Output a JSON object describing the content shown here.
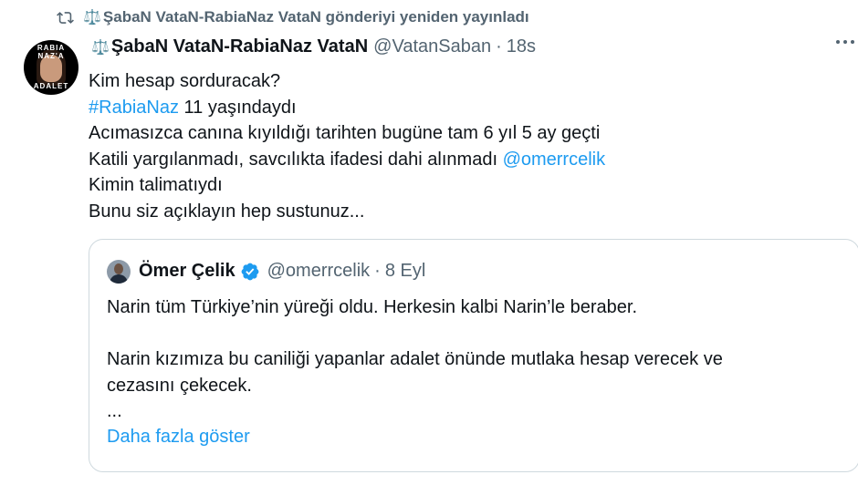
{
  "repost": {
    "icon": "repost-icon",
    "text": "ŞabaN VataN-RabiaNaz VataN gönderiyi yeniden yayınladı"
  },
  "tweet": {
    "avatar_text_top": "RABIA NAZ'A",
    "avatar_text_bottom": "ADALET",
    "display_name": "ŞabaN VataN-RabiaNaz VataN",
    "handle": "@VatanSaban",
    "dot": "·",
    "time": "18s",
    "lines": {
      "l1": "Kim hesap sorduracak?",
      "l2_tag": "#RabiaNaz",
      "l2_rest": " 11 yaşındaydı",
      "l3": "Acımasızca canına kıyıldığı tarihten bugüne tam 6 yıl 5 ay geçti",
      "l4_text": "Katili yargılanmadı, savcılıkta ifadesi dahi alınmadı ",
      "l4_mention": "@omerrcelik",
      "l5": "Kimin talimatıydı",
      "l6": "Bunu siz açıklayın hep sustunuz..."
    }
  },
  "quote": {
    "display_name": "Ömer Çelik",
    "handle": "@omerrcelik",
    "dot": "·",
    "time": "8 Eyl",
    "p1": "Narin tüm Türkiye’nin yüreği oldu. Herkesin kalbi Narin’le beraber.",
    "p2a": "Narin kızımıza bu caniliği yapanlar adalet önünde mutlaka hesap verecek ve",
    "p2b": "cezasını çekecek.",
    "ellipsis": "...",
    "show_more": "Daha fazla göster"
  },
  "colors": {
    "link": "#1d9bf0",
    "secondary": "#536471",
    "text": "#0f1419",
    "border": "#cfd9de"
  }
}
